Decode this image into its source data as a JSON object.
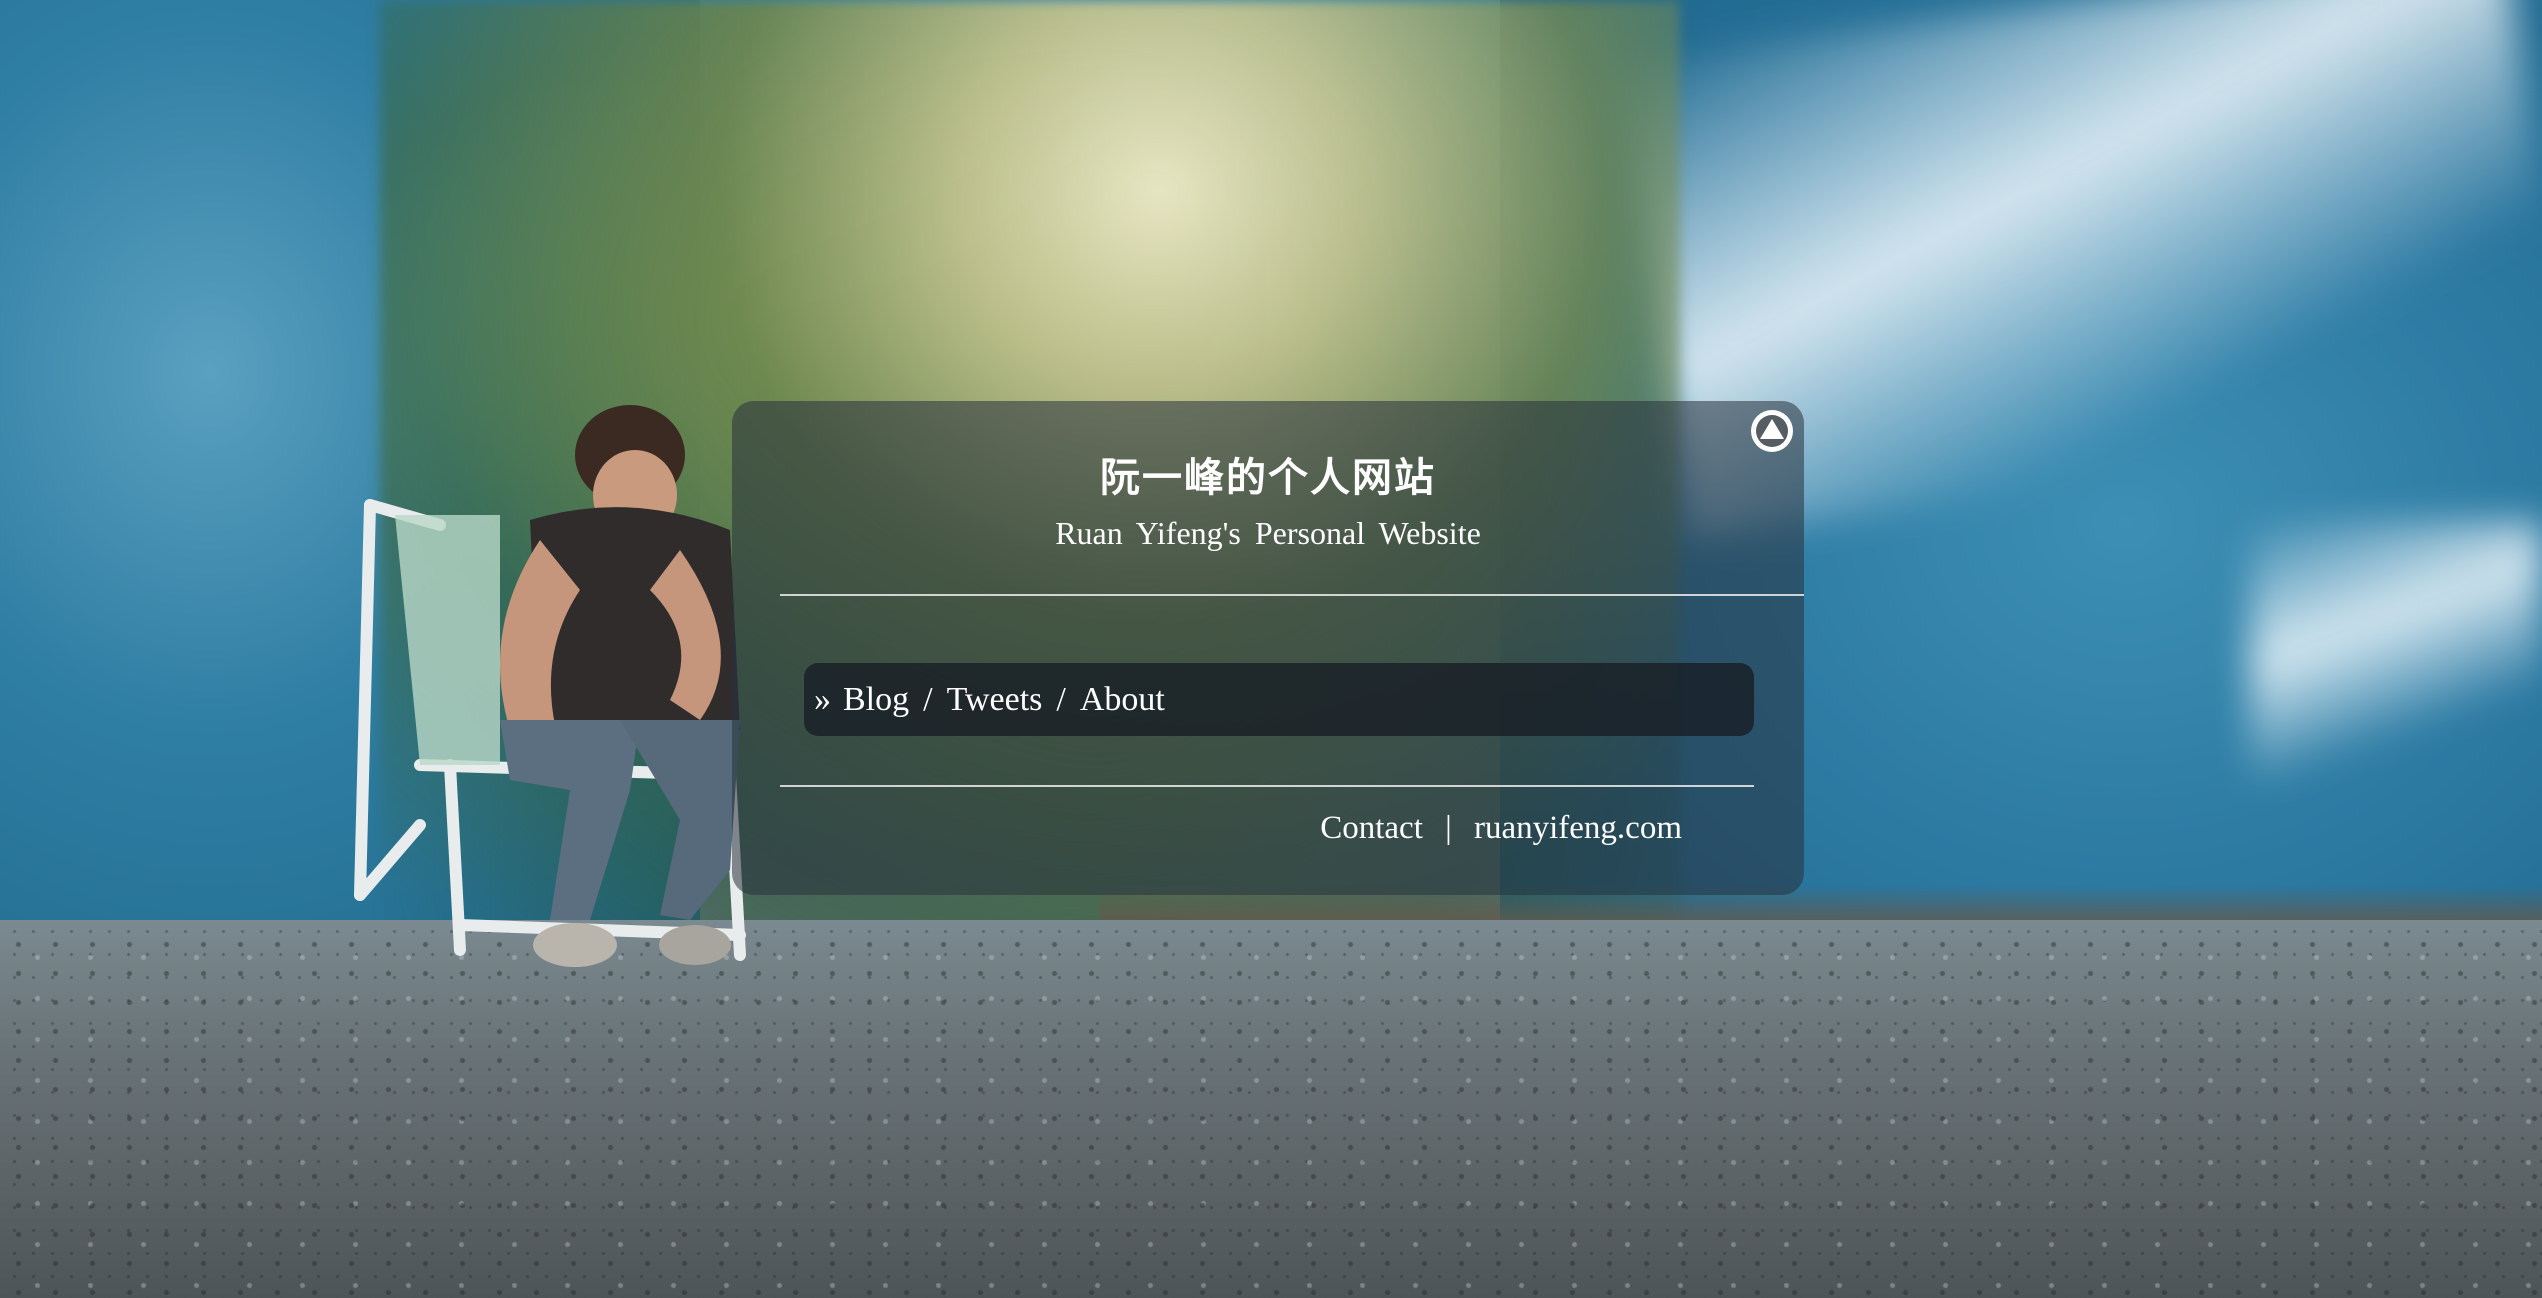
{
  "panel": {
    "title": "阮一峰的个人网站",
    "subtitle": "Ruan Yifeng's Personal Website",
    "collapse_icon": "triangle-up-circle-icon"
  },
  "nav": {
    "marker": "»",
    "items": [
      {
        "label": "Blog"
      },
      {
        "label": "Tweets"
      },
      {
        "label": "About"
      }
    ],
    "separator": "/"
  },
  "footer": {
    "contact_label": "Contact",
    "separator": "|",
    "domain_label": "ruanyifeng.com"
  },
  "colors": {
    "panel_bg": "rgba(40,50,60,0.55)",
    "nav_bg": "rgba(25,30,38,0.82)",
    "text": "#ffffff",
    "wall_blue": "#2f7ea3"
  }
}
